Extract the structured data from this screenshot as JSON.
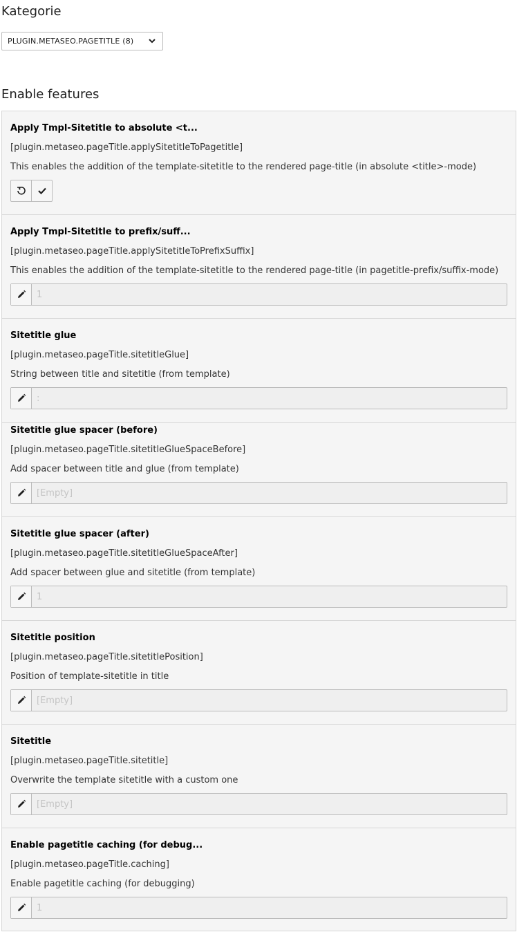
{
  "category": {
    "heading": "Kategorie",
    "selected": "PLUGIN.METASEO.PAGETITLE (8)"
  },
  "section": {
    "heading": "Enable features"
  },
  "settings": [
    {
      "title": "Apply Tmpl-Sitetitle to absolute <t...",
      "key": "[plugin.metaseo.pageTitle.applySitetitleToPagetitle]",
      "description": "This enables the addition of the template-sitetitle to the rendered page-title (in absolute <title>-mode)"
    },
    {
      "title": "Apply Tmpl-Sitetitle to prefix/suff...",
      "key": "[plugin.metaseo.pageTitle.applySitetitleToPrefixSuffix]",
      "description": "This enables the addition of the template-sitetitle to the rendered page-title (in pagetitle-prefix/suffix-mode)",
      "value": "1"
    },
    {
      "title": "Sitetitle glue",
      "key": "[plugin.metaseo.pageTitle.sitetitleGlue]",
      "description": "String between title and sitetitle (from template)",
      "value": ":"
    },
    {
      "title": "Sitetitle glue spacer (before)",
      "key": "[plugin.metaseo.pageTitle.sitetitleGlueSpaceBefore]",
      "description": "Add spacer between title and glue (from template)",
      "value": "[Empty]"
    },
    {
      "title": "Sitetitle glue spacer (after)",
      "key": "[plugin.metaseo.pageTitle.sitetitleGlueSpaceAfter]",
      "description": "Add spacer between glue and sitetitle (from template)",
      "value": "1"
    },
    {
      "title": "Sitetitle position",
      "key": "[plugin.metaseo.pageTitle.sitetitlePosition]",
      "description": "Position of template-sitetitle in title",
      "value": "[Empty]"
    },
    {
      "title": "Sitetitle",
      "key": "[plugin.metaseo.pageTitle.sitetitle]",
      "description": "Overwrite the template sitetitle with a custom one",
      "value": "[Empty]"
    },
    {
      "title": "Enable pagetitle caching (for debug...",
      "key": "[plugin.metaseo.pageTitle.caching]",
      "description": "Enable pagetitle caching (for debugging)",
      "value": "1"
    }
  ],
  "icons": {
    "chevron": "chevron-down-icon",
    "pencil": "pencil-icon",
    "undo": "undo-icon",
    "check": "checkmark-icon"
  }
}
